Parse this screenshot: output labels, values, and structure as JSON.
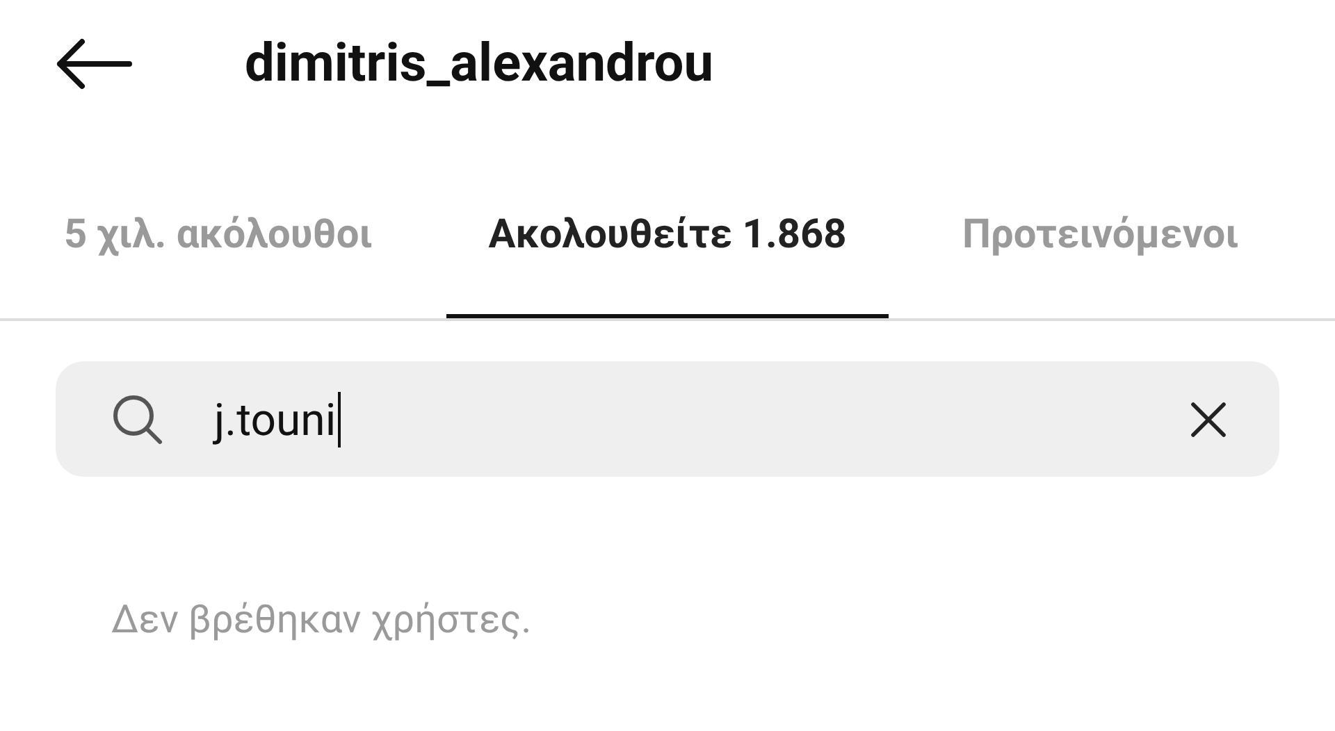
{
  "header": {
    "title": "dimitris_alexandrou"
  },
  "tabs": [
    {
      "label": "5 χιλ. ακόλουθοι",
      "selected": false
    },
    {
      "label": "Ακολουθείτε 1.868",
      "selected": true
    },
    {
      "label": "Προτεινόμενοι",
      "selected": false
    }
  ],
  "search": {
    "value": "j.touni"
  },
  "empty_message": "Δεν βρέθηκαν χρήστες."
}
